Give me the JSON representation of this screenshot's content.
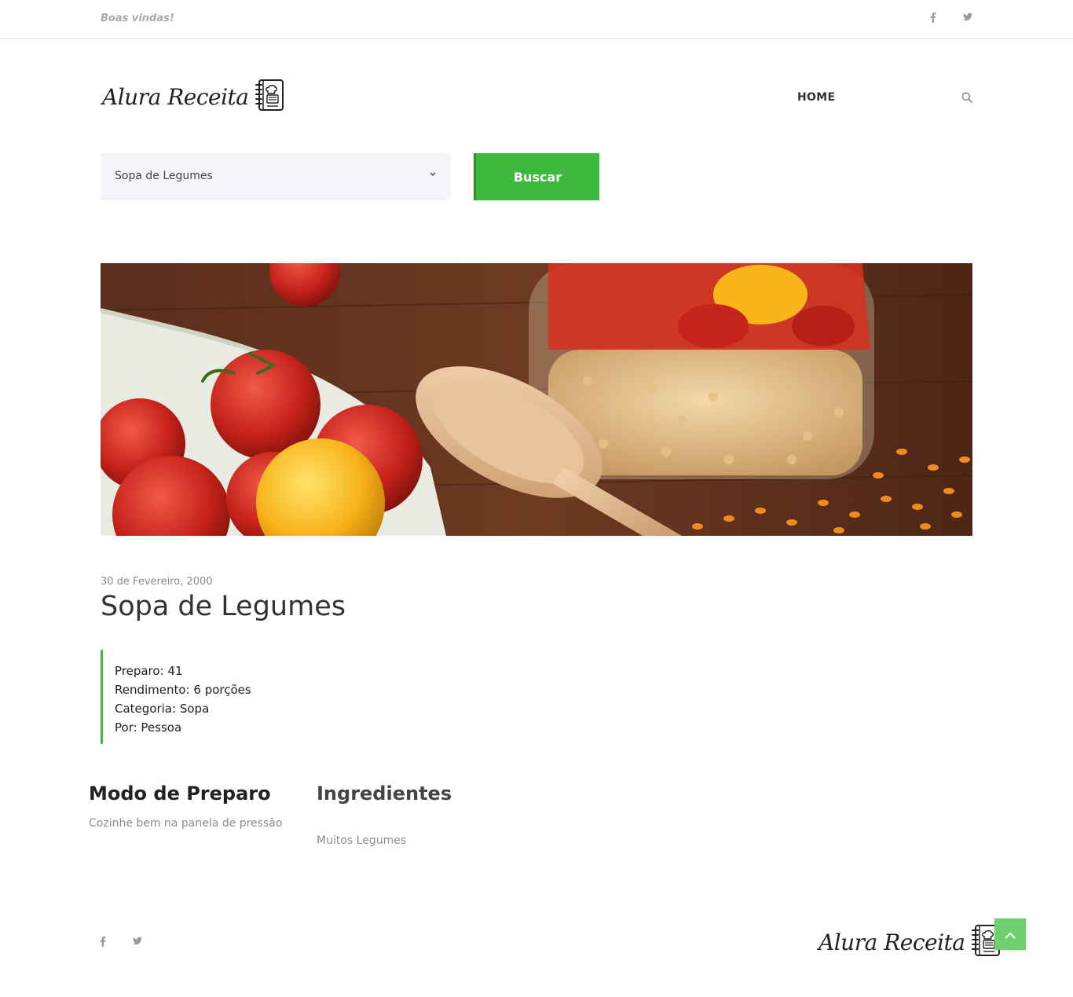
{
  "topbar": {
    "welcome": "Boas vindas!",
    "facebook_icon": "f",
    "twitter_icon": "twitter-icon"
  },
  "header": {
    "logo_text": "Alura Receita",
    "nav_home": "HOME"
  },
  "search": {
    "selected": "Sopa de Legumes",
    "button": "Buscar"
  },
  "recipe": {
    "date": "30 de Fevereiro, 2000",
    "title": "Sopa de Legumes",
    "preparo": "Preparo: 41",
    "rendimento": "Rendimento: 6 porções",
    "categoria": "Categoria: Sopa",
    "por": "Por: Pessoa",
    "modo_title": "Modo de Preparo",
    "modo_text": "Cozinhe bem na panela de pressão",
    "ingredientes_title": "Ingredientes",
    "ingredientes_text": "Muitos Legumes"
  },
  "footer": {
    "logo_text": "Alura Receita"
  },
  "colors": {
    "accent": "#3dba3d",
    "back_to_top": "#6fd06f"
  }
}
